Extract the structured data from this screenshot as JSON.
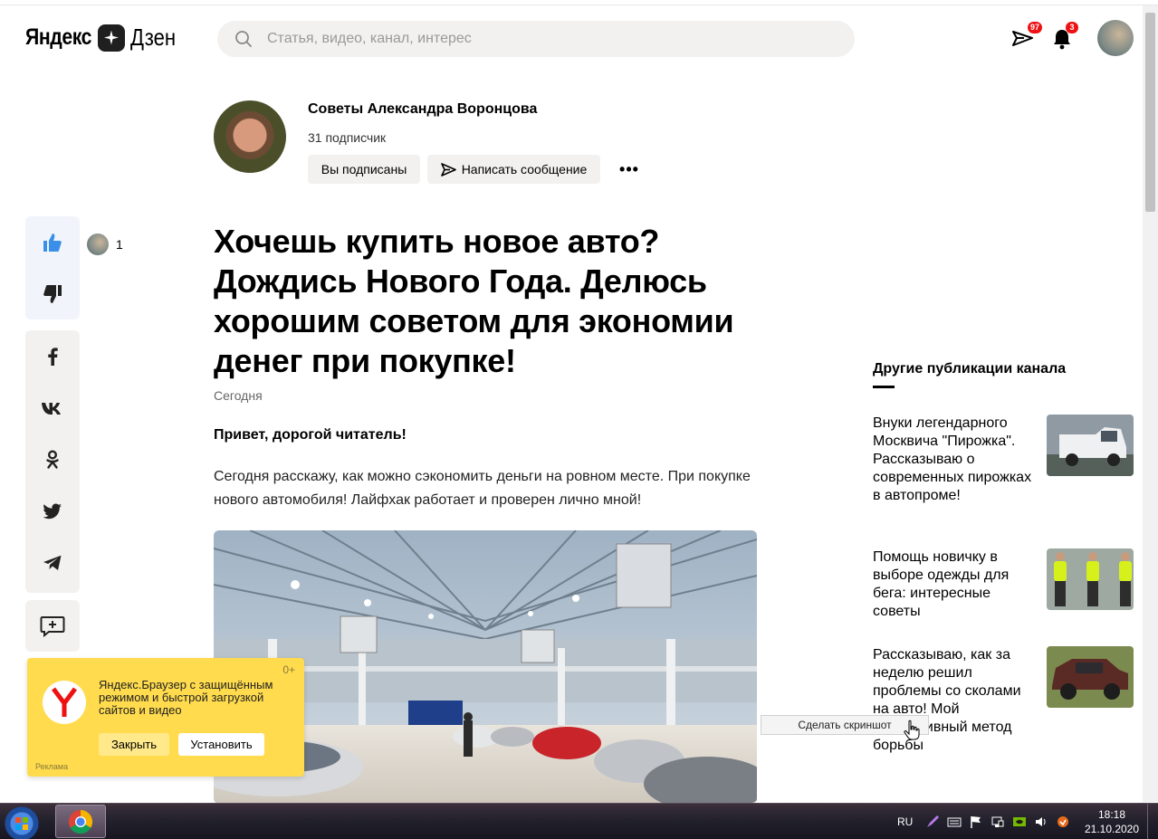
{
  "header": {
    "logo_yandex": "Яндекс",
    "logo_zen": "Дзен",
    "search_placeholder": "Статья, видео, канал, интерес",
    "messages_badge": "97",
    "notifications_badge": "3"
  },
  "channel": {
    "name": "Советы Александра Воронцова",
    "subscribers": "31 подписчик",
    "subscribed_label": "Вы подписаны",
    "message_label": "Написать сообщение",
    "more_label": "•••"
  },
  "reactions": {
    "likes_count": "1"
  },
  "article": {
    "title": "Хочешь купить новое авто? Дождись Нового Года. Делюсь хорошим советом для экономии денег при покупке!",
    "date": "Сегодня",
    "lead": "Привет, дорогой читатель!",
    "paragraph": "Сегодня расскажу, как можно сэкономить деньги на ровном месте. При покупке нового автомобиля! Лайфхак работает и проверен лично мной!"
  },
  "sidebar": {
    "title": "Другие публикации канала",
    "publications": [
      {
        "title": "Внуки легендарного Москвича \"Пирожка\". Рассказываю о современных пирожках в автопроме!"
      },
      {
        "title": "Помощь новичку в выборе одежды для бега: интересные советы"
      },
      {
        "title": "Рассказываю, как за неделю решил проблемы со сколами на авто! Мой эффективный метод борьбы"
      }
    ]
  },
  "tooltip": {
    "label": "Сделать скриншот"
  },
  "ad": {
    "counter": "0+",
    "text": "Яндекс.Браузер с защищённым режимом и быстрой загрузкой сайтов и видео",
    "close_label": "Закрыть",
    "install_label": "Установить",
    "ad_label": "Реклама"
  },
  "taskbar": {
    "lang": "RU",
    "time": "18:18",
    "date": "21.10.2020"
  },
  "colors": {
    "accent_blue": "#3a8fe8",
    "ad_yellow": "#ffdb4d",
    "badge_red": "#e11111"
  }
}
